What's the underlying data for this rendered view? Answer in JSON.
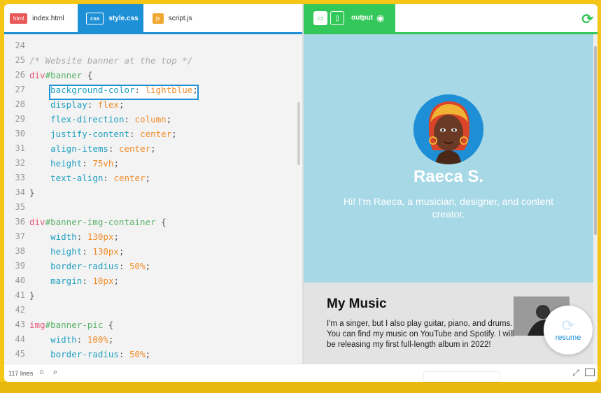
{
  "tabs": [
    {
      "badge": "html",
      "name": "index.html"
    },
    {
      "badge": "css",
      "name": "style.css"
    },
    {
      "badge": "js",
      "name": "script.js"
    }
  ],
  "output": {
    "label": "output"
  },
  "code_lines": [
    {
      "n": "24",
      "tokens": []
    },
    {
      "n": "25",
      "tokens": [
        {
          "c": "cmt",
          "t": "/* Website banner at the top */"
        }
      ]
    },
    {
      "n": "26",
      "tokens": [
        {
          "c": "sel",
          "t": "div"
        },
        {
          "c": "tag",
          "t": "#banner"
        },
        {
          "c": "pun",
          "t": " {"
        }
      ]
    },
    {
      "n": "27",
      "tokens": [
        {
          "c": "pun",
          "t": "    "
        },
        {
          "c": "prop",
          "t": "background-color"
        },
        {
          "c": "pun",
          "t": ": "
        },
        {
          "c": "val",
          "t": "lightblue"
        },
        {
          "c": "pun",
          "t": ";"
        }
      ]
    },
    {
      "n": "28",
      "tokens": [
        {
          "c": "pun",
          "t": "    "
        },
        {
          "c": "prop",
          "t": "display"
        },
        {
          "c": "pun",
          "t": ": "
        },
        {
          "c": "val",
          "t": "flex"
        },
        {
          "c": "pun",
          "t": ";"
        }
      ]
    },
    {
      "n": "29",
      "tokens": [
        {
          "c": "pun",
          "t": "    "
        },
        {
          "c": "prop",
          "t": "flex-direction"
        },
        {
          "c": "pun",
          "t": ": "
        },
        {
          "c": "val",
          "t": "column"
        },
        {
          "c": "pun",
          "t": ";"
        }
      ]
    },
    {
      "n": "30",
      "tokens": [
        {
          "c": "pun",
          "t": "    "
        },
        {
          "c": "prop",
          "t": "justify-content"
        },
        {
          "c": "pun",
          "t": ": "
        },
        {
          "c": "val",
          "t": "center"
        },
        {
          "c": "pun",
          "t": ";"
        }
      ]
    },
    {
      "n": "31",
      "tokens": [
        {
          "c": "pun",
          "t": "    "
        },
        {
          "c": "prop",
          "t": "align-items"
        },
        {
          "c": "pun",
          "t": ": "
        },
        {
          "c": "val",
          "t": "center"
        },
        {
          "c": "pun",
          "t": ";"
        }
      ]
    },
    {
      "n": "32",
      "tokens": [
        {
          "c": "pun",
          "t": "    "
        },
        {
          "c": "prop",
          "t": "height"
        },
        {
          "c": "pun",
          "t": ": "
        },
        {
          "c": "val",
          "t": "75vh"
        },
        {
          "c": "pun",
          "t": ";"
        }
      ]
    },
    {
      "n": "33",
      "tokens": [
        {
          "c": "pun",
          "t": "    "
        },
        {
          "c": "prop",
          "t": "text-align"
        },
        {
          "c": "pun",
          "t": ": "
        },
        {
          "c": "val",
          "t": "center"
        },
        {
          "c": "pun",
          "t": ";"
        }
      ]
    },
    {
      "n": "34",
      "tokens": [
        {
          "c": "pun",
          "t": "}"
        }
      ]
    },
    {
      "n": "35",
      "tokens": []
    },
    {
      "n": "36",
      "tokens": [
        {
          "c": "sel",
          "t": "div"
        },
        {
          "c": "tag",
          "t": "#banner-img-container"
        },
        {
          "c": "pun",
          "t": " {"
        }
      ]
    },
    {
      "n": "37",
      "tokens": [
        {
          "c": "pun",
          "t": "    "
        },
        {
          "c": "prop",
          "t": "width"
        },
        {
          "c": "pun",
          "t": ": "
        },
        {
          "c": "val",
          "t": "130px"
        },
        {
          "c": "pun",
          "t": ";"
        }
      ]
    },
    {
      "n": "38",
      "tokens": [
        {
          "c": "pun",
          "t": "    "
        },
        {
          "c": "prop",
          "t": "height"
        },
        {
          "c": "pun",
          "t": ": "
        },
        {
          "c": "val",
          "t": "130px"
        },
        {
          "c": "pun",
          "t": ";"
        }
      ]
    },
    {
      "n": "39",
      "tokens": [
        {
          "c": "pun",
          "t": "    "
        },
        {
          "c": "prop",
          "t": "border-radius"
        },
        {
          "c": "pun",
          "t": ": "
        },
        {
          "c": "val",
          "t": "50%"
        },
        {
          "c": "pun",
          "t": ";"
        }
      ]
    },
    {
      "n": "40",
      "tokens": [
        {
          "c": "pun",
          "t": "    "
        },
        {
          "c": "prop",
          "t": "margin"
        },
        {
          "c": "pun",
          "t": ": "
        },
        {
          "c": "val",
          "t": "10px"
        },
        {
          "c": "pun",
          "t": ";"
        }
      ]
    },
    {
      "n": "41",
      "tokens": [
        {
          "c": "pun",
          "t": "}"
        }
      ]
    },
    {
      "n": "42",
      "tokens": []
    },
    {
      "n": "43",
      "tokens": [
        {
          "c": "sel",
          "t": "img"
        },
        {
          "c": "tag",
          "t": "#banner-pic"
        },
        {
          "c": "pun",
          "t": " {"
        }
      ]
    },
    {
      "n": "44",
      "tokens": [
        {
          "c": "pun",
          "t": "    "
        },
        {
          "c": "prop",
          "t": "width"
        },
        {
          "c": "pun",
          "t": ": "
        },
        {
          "c": "val",
          "t": "100%"
        },
        {
          "c": "pun",
          "t": ";"
        }
      ]
    },
    {
      "n": "45",
      "tokens": [
        {
          "c": "pun",
          "t": "    "
        },
        {
          "c": "prop",
          "t": "border-radius"
        },
        {
          "c": "pun",
          "t": ": "
        },
        {
          "c": "val",
          "t": "50%"
        },
        {
          "c": "pun",
          "t": ";"
        }
      ]
    }
  ],
  "preview": {
    "name": "Raeca S.",
    "bio": "Hi! I'm Raeca, a musician, designer, and content creator.",
    "music_title": "My Music",
    "music_text": "I'm a singer, but I also play guitar, piano, and drums. You can find my music on YouTube and Spotify. I will be releasing my first full-length album in 2022!"
  },
  "resume": {
    "label": "resume"
  },
  "status": {
    "lines": "117 lines"
  },
  "colors": {
    "accent_blue": "#1e90d6",
    "accent_green": "#34c759",
    "banner": "#a7d8e6",
    "frame": "#f5c518"
  }
}
